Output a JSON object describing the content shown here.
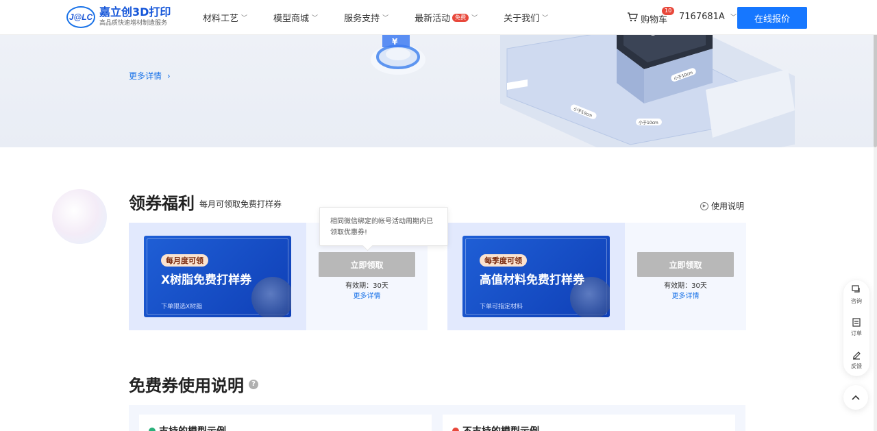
{
  "header": {
    "logo_mark": "J@LC",
    "logo_title": "嘉立创3D打印",
    "logo_sub": "高品质快速增材制造服务",
    "nav": [
      {
        "label": "材料工艺"
      },
      {
        "label": "模型商城"
      },
      {
        "label": "服务支持"
      },
      {
        "label": "最新活动",
        "badge": "免费"
      },
      {
        "label": "关于我们"
      }
    ],
    "cart_label": "购物车",
    "cart_count": "10",
    "user": "7167681A",
    "quote_button": "在线报价"
  },
  "hero": {
    "more_link": "更多详情",
    "dimension_labels": [
      "小于10cm",
      "小于10cm",
      "小于10cm"
    ]
  },
  "coupons": {
    "title": "领券福利",
    "subtitle": "每月可领取免费打样券",
    "usage_link": "使用说明",
    "tooltip": "相同微信绑定的帐号活动周期内已领取优惠券!",
    "cards": [
      {
        "tag": "每月度可领",
        "title": "X树脂免费打样券",
        "desc": "下单限选X树脂",
        "claim": "立即领取",
        "validity": "有效期：30天",
        "detail": "更多详情"
      },
      {
        "tag": "每季度可领",
        "title": "高值材料免费打样券",
        "desc": "下单可指定材料",
        "claim": "立即领取",
        "validity": "有效期：30天",
        "detail": "更多详情"
      }
    ]
  },
  "usage": {
    "title": "免费券使用说明",
    "supported": "支持的模型示例",
    "unsupported": "不支持的模型示例"
  },
  "float_bar": {
    "consult": "咨询",
    "orders": "订单",
    "feedback": "反馈"
  },
  "colors": {
    "primary": "#1677ff",
    "ticket": "#1247c4",
    "disabled_button": "#b8b8b8"
  }
}
